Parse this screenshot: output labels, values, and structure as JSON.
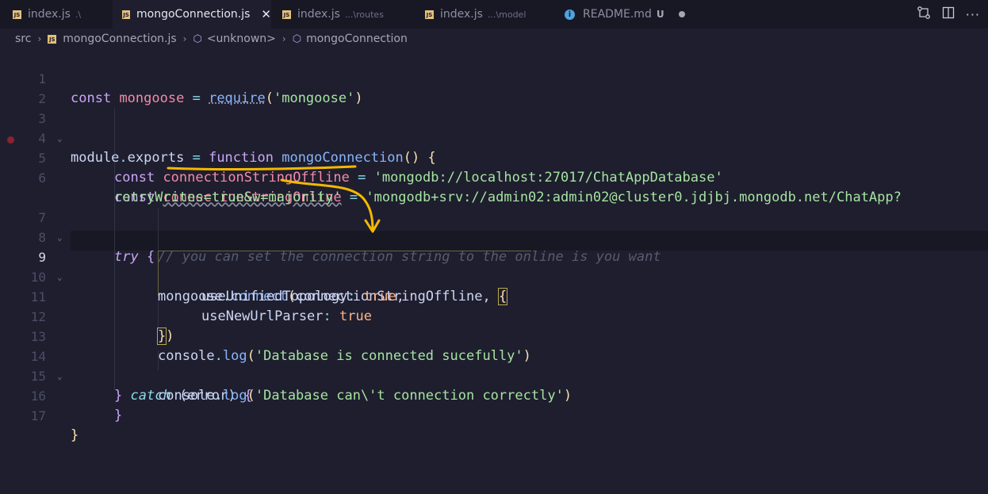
{
  "tabs": [
    {
      "label": "index.js",
      "path": ".\\",
      "active": false
    },
    {
      "label": "mongoConnection.js",
      "path": "",
      "active": true
    },
    {
      "label": "index.js",
      "path": "...\\routes",
      "active": false
    },
    {
      "label": "index.js",
      "path": "...\\model",
      "active": false
    },
    {
      "label": "README.md",
      "status": "U",
      "active": false
    }
  ],
  "breadcrumb": {
    "root": "src",
    "file": "mongoConnection.js",
    "scope": "<unknown>",
    "symbol": "mongoConnection"
  },
  "editor": {
    "current_line": 9,
    "breakpoint_line": 5,
    "line_numbers": [
      "1",
      "2",
      "3",
      "4",
      "5",
      "6",
      "7",
      "8",
      "9",
      "10",
      "11",
      "12",
      "13",
      "14",
      "15",
      "16",
      "17"
    ],
    "code": {
      "l1_const": "const",
      "l1_var": "mongoose",
      "l1_req": "require",
      "l1_str": "'mongoose'",
      "l3_module": "module",
      "l3_exports": "exports",
      "l3_function": "function",
      "l3_name": "mongoConnection",
      "l5_const": "const",
      "l5_var": "connectionStringOffline",
      "l5_str": "'mongodb://localhost:27017/ChatAppDatabase'",
      "l6_const": "const",
      "l6_var": "connectionStringOnline",
      "l6_str": "'mongodb+srv://admin02:admin02@cluster0.jdjbj.mongodb.net/ChatApp?",
      "l6_str_wrap": "retryWrites=true&w=majority'",
      "l7_try": "try",
      "l8_comment": "// you can set the connection string to the online is you want",
      "l9_obj": "mongoose",
      "l9_fn": "connect",
      "l9_arg": "connectionStringOffline",
      "l10_key": "useUnifiedTopology",
      "l10_val": "true",
      "l11_key": "useNewUrlParser",
      "l11_val": "true",
      "l13_obj": "console",
      "l13_fn": "log",
      "l13_str": "'Database is connected sucefully'",
      "l14_catch": "catch",
      "l14_err": "error",
      "l15_obj": "console",
      "l15_fn": "log",
      "l15_str": "'Database can\\'t connection correctly'"
    }
  },
  "annotation_color": "#f5b800"
}
